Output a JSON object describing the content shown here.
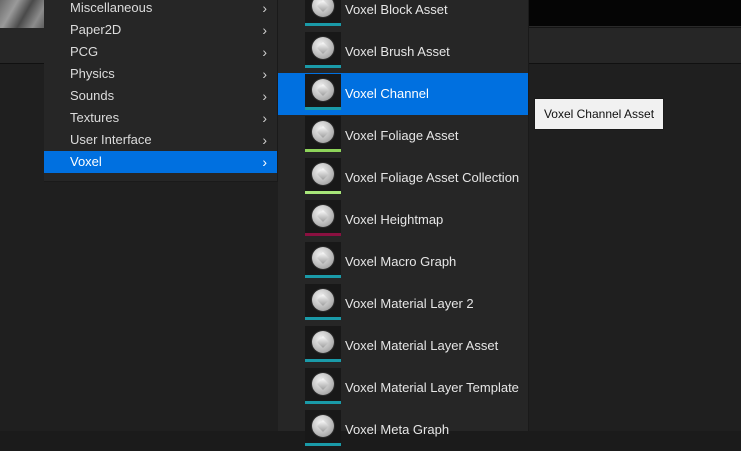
{
  "categories": [
    {
      "label": "Miscellaneous",
      "active": false
    },
    {
      "label": "Paper2D",
      "active": false
    },
    {
      "label": "PCG",
      "active": false
    },
    {
      "label": "Physics",
      "active": false
    },
    {
      "label": "Sounds",
      "active": false
    },
    {
      "label": "Textures",
      "active": false
    },
    {
      "label": "User Interface",
      "active": false
    },
    {
      "label": "Voxel",
      "active": true
    }
  ],
  "submenu_arrow": "›",
  "assets": [
    {
      "label": "Voxel Block Asset",
      "icon": "voxel-cube-icon",
      "color": "#1a9aa8",
      "active": false
    },
    {
      "label": "Voxel Brush Asset",
      "icon": "voxel-cube-icon",
      "color": "#1a9aa8",
      "active": false
    },
    {
      "label": "Voxel Channel",
      "icon": "voxel-cube-icon",
      "color": "#1a9aa8",
      "active": true
    },
    {
      "label": "Voxel Foliage Asset",
      "icon": "voxel-cube-icon",
      "color": "#8ed45a",
      "active": false
    },
    {
      "label": "Voxel Foliage Asset Collection",
      "icon": "voxel-cube-icon",
      "color": "#a8e67a",
      "active": false
    },
    {
      "label": "Voxel Heightmap",
      "icon": "voxel-cube-icon",
      "color": "#8a1040",
      "active": false
    },
    {
      "label": "Voxel Macro Graph",
      "icon": "voxel-cube-icon",
      "color": "#1a9aa8",
      "active": false
    },
    {
      "label": "Voxel Material Layer 2",
      "icon": "voxel-cube-icon",
      "color": "#1a9aa8",
      "active": false
    },
    {
      "label": "Voxel Material Layer Asset",
      "icon": "voxel-cube-icon",
      "color": "#1a9aa8",
      "active": false
    },
    {
      "label": "Voxel Material Layer Template",
      "icon": "voxel-cube-icon",
      "color": "#1a9aa8",
      "active": false
    },
    {
      "label": "Voxel Meta Graph",
      "icon": "voxel-cube-icon",
      "color": "#1a9aa8",
      "active": false
    }
  ],
  "tooltip": "Voxel Channel Asset",
  "colors": {
    "accent": "#0070e0",
    "menu_bg": "#262626",
    "background": "#1b1b1b"
  }
}
